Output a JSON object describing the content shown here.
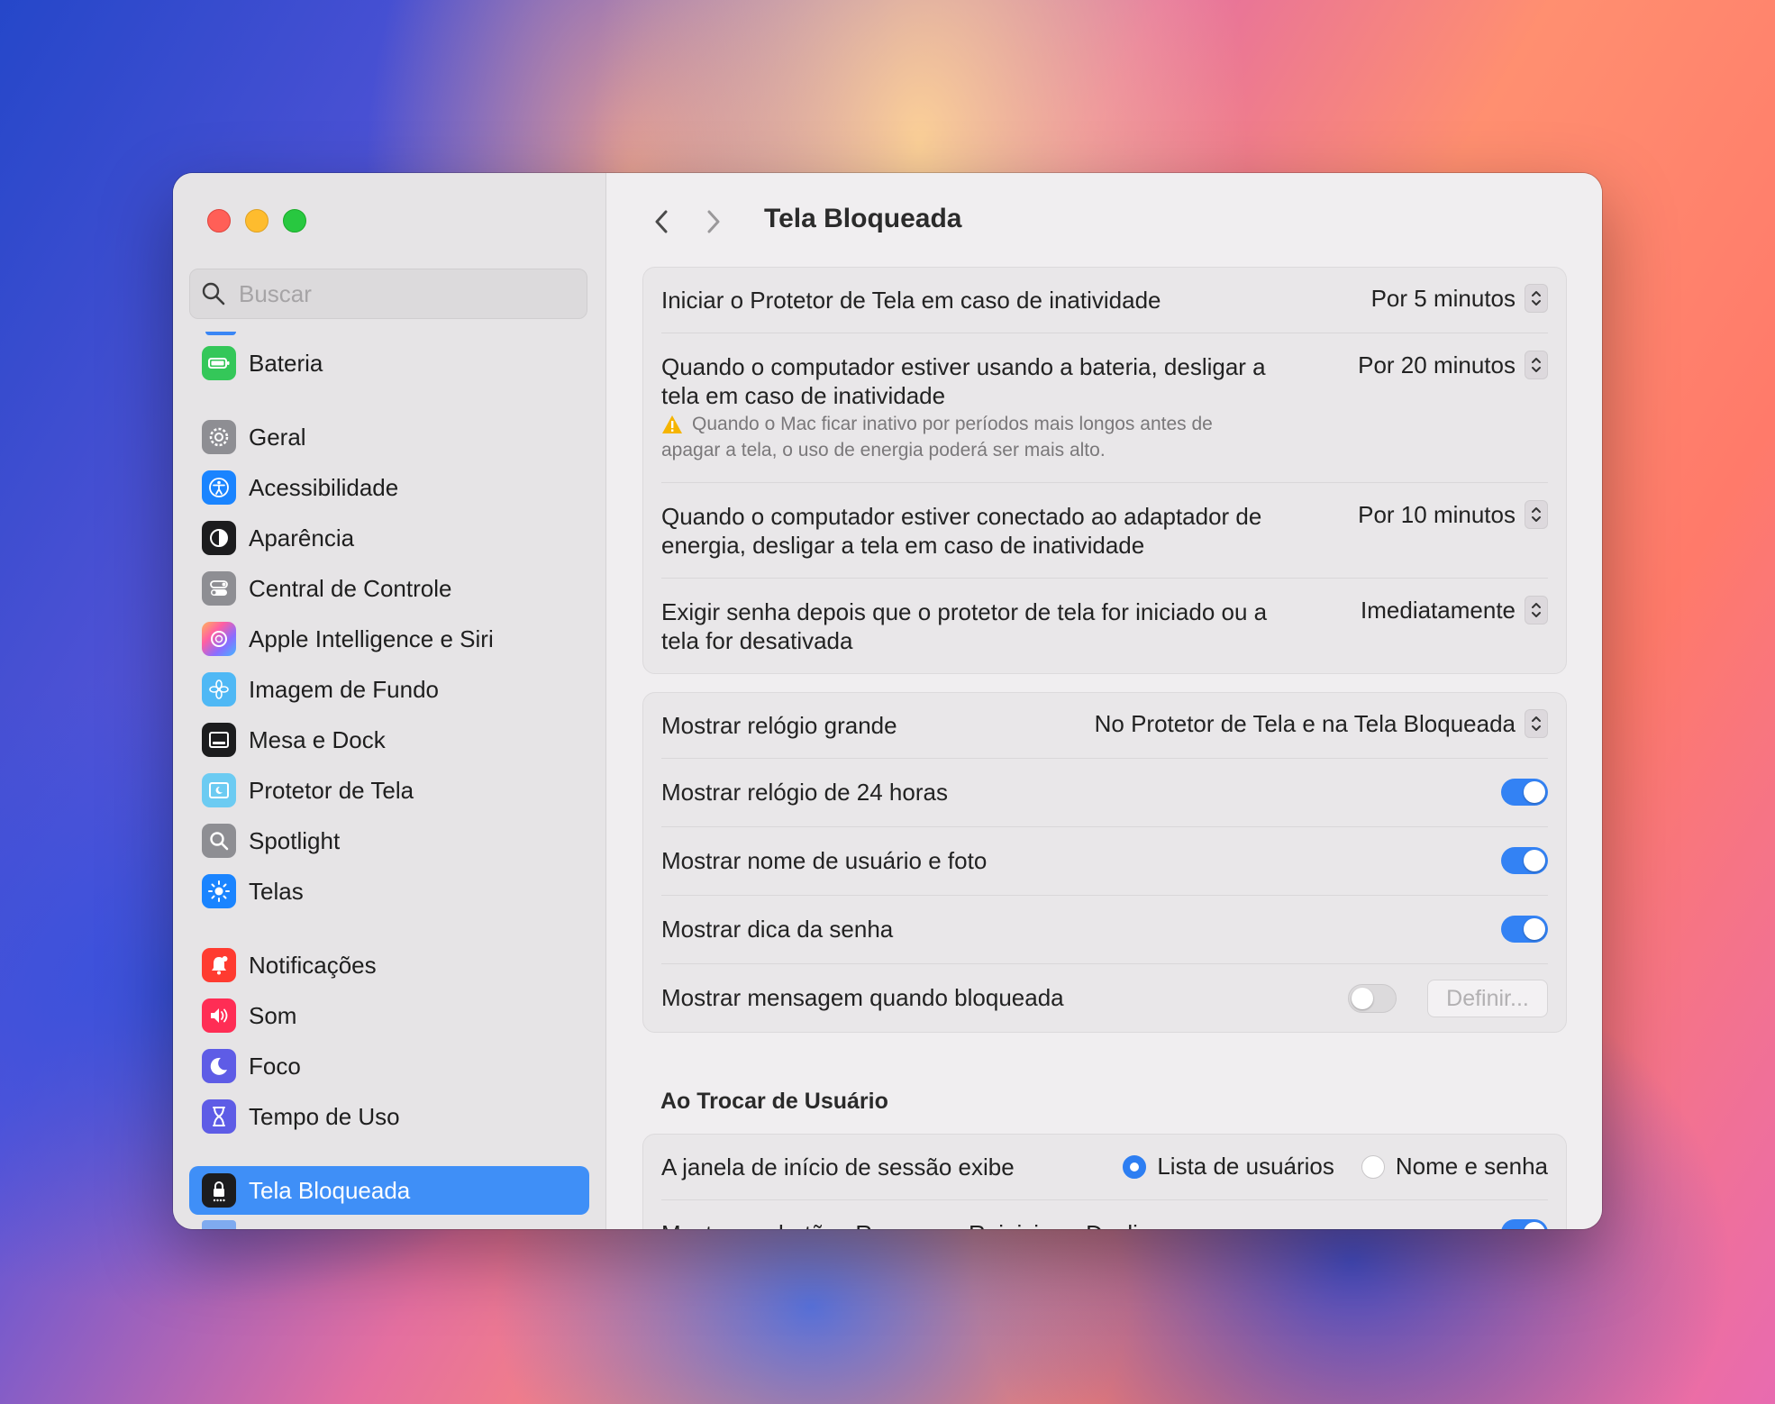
{
  "window": {
    "title": "Tela Bloqueada"
  },
  "sidebar": {
    "search_placeholder": "Buscar",
    "items": [
      {
        "label": "Bateria",
        "icon": "battery-icon",
        "color": "#34c759"
      },
      {
        "label": "Geral",
        "icon": "gear-icon",
        "color": "#8e8e93"
      },
      {
        "label": "Acessibilidade",
        "icon": "accessibility-icon",
        "color": "#1a84ff"
      },
      {
        "label": "Aparência",
        "icon": "appearance-icon",
        "color": "#1c1c1e"
      },
      {
        "label": "Central de Controle",
        "icon": "control-center-icon",
        "color": "#8e8e93"
      },
      {
        "label": "Apple Intelligence e Siri",
        "icon": "siri-icon",
        "color": "#ff6fa7"
      },
      {
        "label": "Imagem de Fundo",
        "icon": "wallpaper-icon",
        "color": "#4fb8f5"
      },
      {
        "label": "Mesa e Dock",
        "icon": "dock-icon",
        "color": "#1c1c1e"
      },
      {
        "label": "Protetor de Tela",
        "icon": "screensaver-icon",
        "color": "#6ccbf2"
      },
      {
        "label": "Spotlight",
        "icon": "spotlight-icon",
        "color": "#8e8e93"
      },
      {
        "label": "Telas",
        "icon": "displays-icon",
        "color": "#1a84ff"
      },
      {
        "label": "Notificações",
        "icon": "notifications-icon",
        "color": "#ff3b30"
      },
      {
        "label": "Som",
        "icon": "sound-icon",
        "color": "#ff2d55"
      },
      {
        "label": "Foco",
        "icon": "focus-moon-icon",
        "color": "#5e5ce6"
      },
      {
        "label": "Tempo de Uso",
        "icon": "hourglass-icon",
        "color": "#5e5ce6"
      },
      {
        "label": "Tela Bloqueada",
        "icon": "lock-icon",
        "color": "#1c1c1e",
        "active": true
      }
    ]
  },
  "content": {
    "title": "Tela Bloqueada",
    "group1": {
      "rows": [
        {
          "label": "Iniciar o Protetor de Tela em caso de inatividade",
          "value": "Por 5 minutos"
        },
        {
          "label_line1": "Quando o computador estiver usando a bateria, desligar a",
          "label_line2": "tela em caso de inatividade",
          "value": "Por 20 minutos",
          "note_line1": "Quando o Mac ficar inativo por períodos mais longos antes de",
          "note_line2": "apagar a tela, o uso de energia poderá ser mais alto."
        },
        {
          "label_line1": "Quando o computador estiver conectado ao adaptador de",
          "label_line2": "energia, desligar a tela em caso de inatividade",
          "value": "Por 10 minutos"
        },
        {
          "label_line1": "Exigir senha depois que o protetor de tela for iniciado ou a",
          "label_line2": "tela for desativada",
          "value": "Imediatamente"
        }
      ]
    },
    "group2": {
      "rows": [
        {
          "label": "Mostrar relógio grande",
          "value": "No Protetor de Tela e na Tela Bloqueada"
        },
        {
          "label": "Mostrar relógio de 24 horas",
          "toggle": true
        },
        {
          "label": "Mostrar nome de usuário e foto",
          "toggle": true
        },
        {
          "label": "Mostrar dica da senha",
          "toggle": true
        },
        {
          "label": "Mostrar mensagem quando bloqueada",
          "toggle": false,
          "button": "Definir..."
        }
      ]
    },
    "section": {
      "title": "Ao Trocar de Usuário",
      "login_label": "A janela de início de sessão exibe",
      "option1": "Lista de usuários",
      "option2": "Nome e senha",
      "selected": "Lista de usuários",
      "partial_row": "Mostrar os botões Repousar, Reiniciar e Desligar"
    }
  }
}
